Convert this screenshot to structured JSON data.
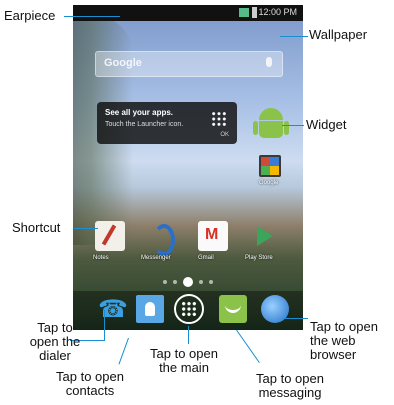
{
  "callouts": {
    "earpiece": "Earpiece",
    "wallpaper": "Wallpaper",
    "widget": "Widget",
    "shortcut": "Shortcut",
    "dialer": "Tap to\nopen the\ndialer",
    "contacts": "Tap to open\ncontacts",
    "main_menu": "Tap to open\nthe main",
    "messaging": "Tap to open\nmessaging",
    "browser": "Tap to open\nthe web\nbrowser"
  },
  "status_bar": {
    "time": "12:00 PM"
  },
  "tooltip": {
    "title": "See all your apps.",
    "body": "Touch the Launcher icon.",
    "dismiss": "OK"
  },
  "app_labels": {
    "folder": "Google",
    "shortcut_1": "Notes",
    "shortcut_2": "Messenger",
    "shortcut_3": "Gmail",
    "shortcut_4": "Play Store"
  },
  "icons": {
    "dock": [
      "phone-icon",
      "contacts-icon",
      "apps-launcher-icon",
      "messaging-icon",
      "browser-icon"
    ]
  },
  "colors": {
    "callout_line": "#1a8fd0"
  }
}
